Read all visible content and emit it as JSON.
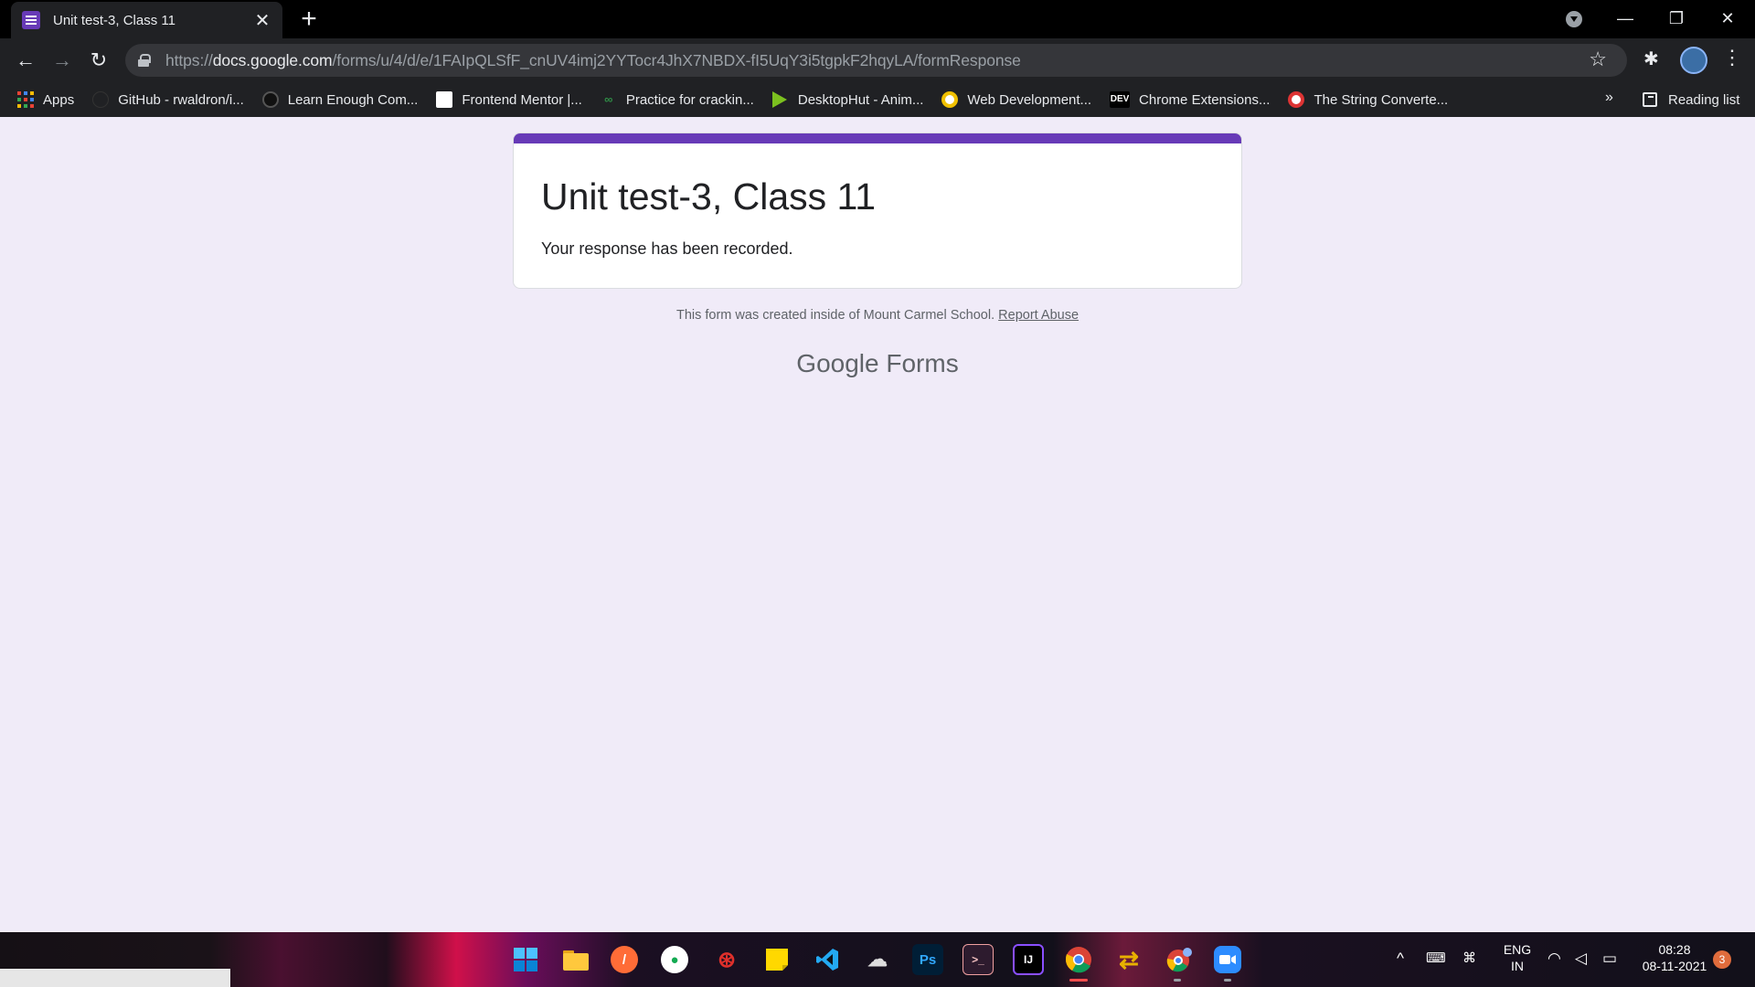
{
  "browser": {
    "tab": {
      "title": "Unit test-3, Class 11",
      "close": "✕"
    },
    "new_tab": "+",
    "window": {
      "minimize": "—",
      "maximize": "❐",
      "close": "✕"
    },
    "url": {
      "scheme": "https://",
      "host": "docs.google.com",
      "path": "/forms/u/4/d/e/1FAIpQLSfF_cnUV4imj2YYTocr4JhX7NBDX-fI5UqY3i5tgpkF2hqyLA/formResponse"
    },
    "nav": {
      "back": "←",
      "forward": "→",
      "reload": "↻"
    },
    "star": "☆",
    "extensions": "✱",
    "menu": "⋮",
    "bookmarks": [
      {
        "label": "Apps",
        "icon": "apps-grid-icon"
      },
      {
        "label": "GitHub - rwaldron/i...",
        "icon": "github-icon"
      },
      {
        "label": "Learn Enough Com...",
        "icon": "learn-enough-icon"
      },
      {
        "label": "Frontend Mentor |...",
        "icon": "frontend-mentor-icon"
      },
      {
        "label": "Practice for crackin...",
        "icon": "geeksforgeeks-icon"
      },
      {
        "label": "DesktopHut - Anim...",
        "icon": "desktophut-icon"
      },
      {
        "label": "Web Development...",
        "icon": "web-dev-icon"
      },
      {
        "label": "Chrome Extensions...",
        "icon": "dev-icon"
      },
      {
        "label": "The String Converte...",
        "icon": "string-converter-icon"
      }
    ],
    "bookmarks_more": "»",
    "reading_list": "Reading list"
  },
  "form": {
    "title": "Unit test-3, Class 11",
    "message": "Your response has been recorded.",
    "footer": "This form was created inside of Mount Carmel School.",
    "report_abuse": "Report Abuse",
    "brand_google": "Google",
    "brand_forms": "Forms",
    "accent_color": "#673ab7",
    "background_color": "#f0ebf8"
  },
  "taskbar": {
    "icons": [
      "windows-start-icon",
      "file-explorer-icon",
      "postman-icon",
      "mongodb-compass-icon",
      "brave-icon",
      "sticky-notes-icon",
      "vscode-icon",
      "github-desktop-icon",
      "photoshop-icon",
      "terminal-icon",
      "intellij-icon",
      "chrome-icon",
      "arduino-icon",
      "chrome-profile-icon",
      "zoom-icon"
    ],
    "ps_label": "Ps",
    "ij_label": "IJ",
    "terminal_label": ">_",
    "language": "ENG",
    "region": "IN",
    "time": "08:28",
    "date": "08-11-2021",
    "notifications": "3",
    "tray_chevron": "^"
  }
}
